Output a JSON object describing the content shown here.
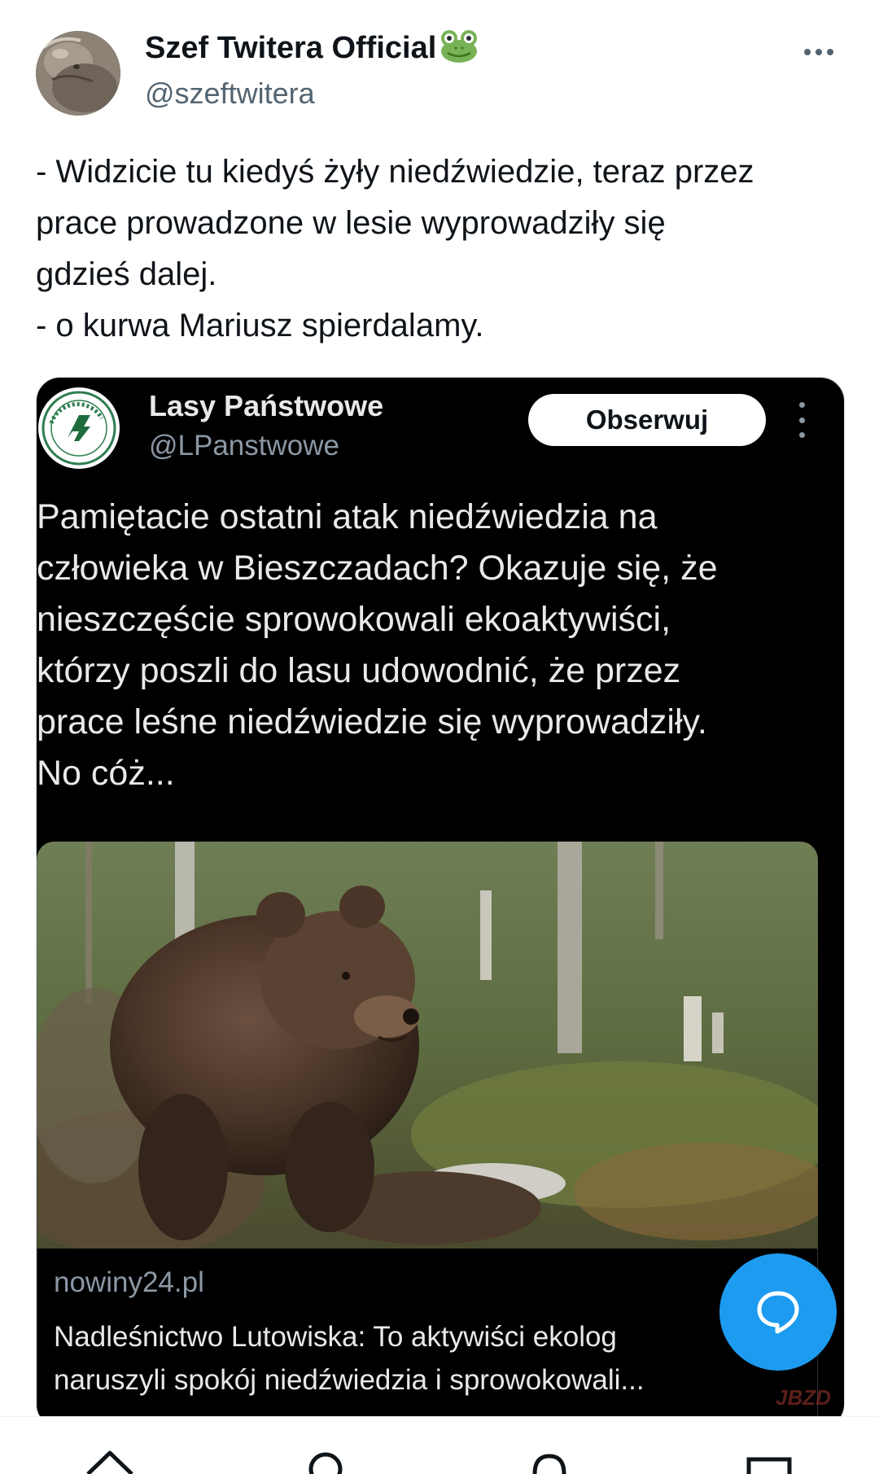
{
  "tweet": {
    "author_name": "Szef Twitera Official",
    "author_handle": "@szeftwitera",
    "text_lines": [
      "- Widzicie tu kiedyś żyły niedźwiedzie, teraz przez",
      "prace prowadzone w lesie wyprowadziły się",
      "gdzieś dalej.",
      "- o kurwa Mariusz spierdalamy."
    ]
  },
  "embedded": {
    "author_name": "Lasy Państwowe",
    "author_handle": "@LPanstwowe",
    "follow_label": "Obserwuj",
    "text_lines": [
      "Pamiętacie ostatni atak niedźwiedzia na",
      "człowieka w Bieszczadach? Okazuje się, że",
      "nieszczęście sprowokowali  ekoaktywiści,",
      "którzy poszli do lasu udowodnić, że przez",
      "prace leśne niedźwiedzie się wyprowadziły.",
      "No cóż..."
    ],
    "link": {
      "domain": "nowiny24.pl",
      "title_lines": [
        "Nadleśnictwo Lutowiska: To aktywiści ekolog",
        "naruszyli spokój niedźwiedzia i sprowokowali..."
      ]
    },
    "watermark": "JBZD"
  },
  "icons": {
    "emoji": "frog-icon",
    "more": "more-icon",
    "reply_fab": "compose-reply-icon",
    "nav": [
      "home-icon",
      "search-icon",
      "notifications-icon",
      "messages-icon"
    ]
  },
  "colors": {
    "accent": "#1d9bf0",
    "text_primary": "#0f1419",
    "text_secondary": "#536471",
    "card_background": "#000000"
  }
}
